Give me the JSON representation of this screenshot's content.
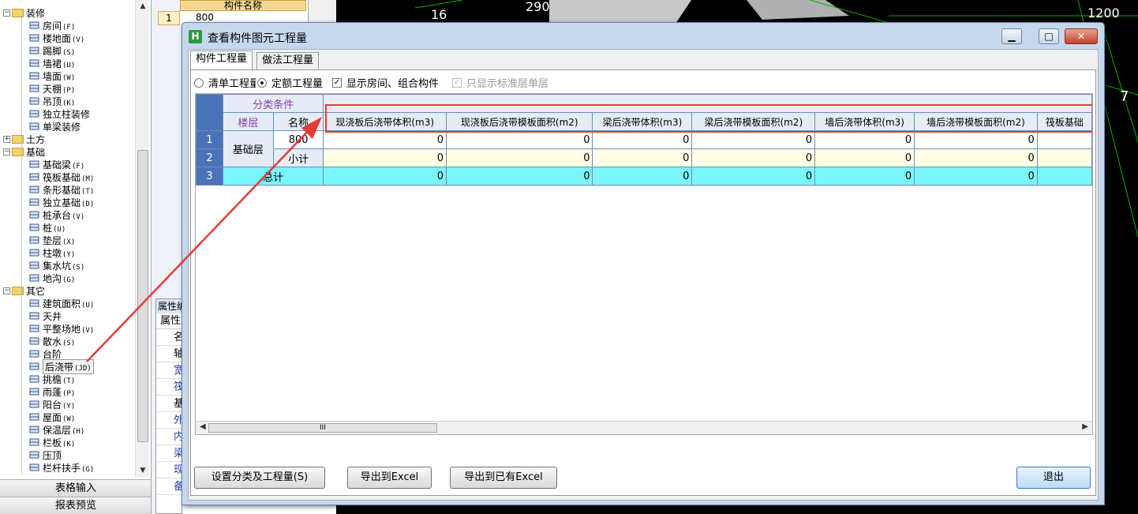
{
  "tree": {
    "categories": [
      {
        "label": "装修",
        "items": [
          {
            "label": "房间",
            "hotkey": "(F)",
            "icon": "room-icon"
          },
          {
            "label": "楼地面",
            "hotkey": "(V)",
            "icon": "floor-icon"
          },
          {
            "label": "踢脚",
            "hotkey": "(S)",
            "icon": "skirting-icon"
          },
          {
            "label": "墙裙",
            "hotkey": "(U)",
            "icon": "wainscot-icon"
          },
          {
            "label": "墙面",
            "hotkey": "(W)",
            "icon": "wall-surface-icon"
          },
          {
            "label": "天棚",
            "hotkey": "(P)",
            "icon": "ceiling-icon"
          },
          {
            "label": "吊顶",
            "hotkey": "(K)",
            "icon": "suspended-ceiling-icon"
          },
          {
            "label": "独立柱装修",
            "hotkey": "",
            "icon": "column-finish-icon"
          },
          {
            "label": "单梁装修",
            "hotkey": "",
            "icon": "beam-finish-icon"
          }
        ]
      },
      {
        "label": "土方",
        "items": []
      },
      {
        "label": "基础",
        "items": [
          {
            "label": "基础梁",
            "hotkey": "(F)",
            "icon": "foundation-beam-icon"
          },
          {
            "label": "筏板基础",
            "hotkey": "(M)",
            "icon": "raft-icon"
          },
          {
            "label": "条形基础",
            "hotkey": "(T)",
            "icon": "strip-foundation-icon"
          },
          {
            "label": "独立基础",
            "hotkey": "(D)",
            "icon": "isolated-foundation-icon"
          },
          {
            "label": "桩承台",
            "hotkey": "(V)",
            "icon": "pile-cap-icon"
          },
          {
            "label": "桩",
            "hotkey": "(U)",
            "icon": "pile-icon"
          },
          {
            "label": "垫层",
            "hotkey": "(X)",
            "icon": "cushion-icon"
          },
          {
            "label": "柱墩",
            "hotkey": "(Y)",
            "icon": "column-pier-icon"
          },
          {
            "label": "集水坑",
            "hotkey": "(S)",
            "icon": "sump-icon"
          },
          {
            "label": "地沟",
            "hotkey": "(G)",
            "icon": "trench-icon"
          }
        ]
      },
      {
        "label": "其它",
        "items": [
          {
            "label": "建筑面积",
            "hotkey": "(U)",
            "icon": "building-area-icon"
          },
          {
            "label": "天井",
            "hotkey": "",
            "icon": "patio-icon"
          },
          {
            "label": "平整场地",
            "hotkey": "(V)",
            "icon": "site-leveling-icon"
          },
          {
            "label": "散水",
            "hotkey": "(S)",
            "icon": "apron-icon"
          },
          {
            "label": "台阶",
            "hotkey": "",
            "icon": "steps-icon"
          },
          {
            "label": "后浇带",
            "hotkey": "(JD)",
            "icon": "post-cast-strip-icon"
          },
          {
            "label": "挑檐",
            "hotkey": "(T)",
            "icon": "eave-icon"
          },
          {
            "label": "雨蓬",
            "hotkey": "(P)",
            "icon": "canopy-icon"
          },
          {
            "label": "阳台",
            "hotkey": "(Y)",
            "icon": "balcony-icon"
          },
          {
            "label": "屋面",
            "hotkey": "(W)",
            "icon": "roof-icon"
          },
          {
            "label": "保温层",
            "hotkey": "(H)",
            "icon": "insulation-icon"
          },
          {
            "label": "栏板",
            "hotkey": "(K)",
            "icon": "parapet-icon"
          },
          {
            "label": "压顶",
            "hotkey": "",
            "icon": "coping-icon"
          },
          {
            "label": "栏杆扶手",
            "hotkey": "(G)",
            "icon": "railing-icon"
          }
        ]
      }
    ],
    "bottom_tabs": [
      "表格输入",
      "报表预览"
    ]
  },
  "behind": {
    "grid_header": "构件名称",
    "row_num": "1",
    "row_value": "800",
    "attr_title": "属性编",
    "attr_header": "属性",
    "attr_chars": [
      "名",
      "轴",
      "宽",
      "筏",
      "基",
      "外",
      "内",
      "梁",
      "现",
      "备"
    ]
  },
  "canvas": {
    "labels": [
      "16",
      "290",
      "1200",
      "7"
    ],
    "accent": "#00c000"
  },
  "dialog": {
    "title": "查看构件图元工程量",
    "controls": {
      "minimize": "▁",
      "maximize": "□",
      "close": "✕"
    },
    "tabs": [
      "构件工程量",
      "做法工程量"
    ],
    "options": {
      "radio_list": "清单工程量",
      "radio_quota": "定额工程量",
      "check_show_room": "显示房间、组合构件",
      "check_std_floor": "只显示标准层单层"
    },
    "grid": {
      "group_header": "分类条件",
      "col_floor": "楼层",
      "col_name": "名称",
      "quantity_headers": [
        "现浇板后浇带体积(m3)",
        "现浇板后浇带模板面积(m2)",
        "梁后浇带体积(m3)",
        "梁后浇带模板面积(m2)",
        "墙后浇带体积(m3)",
        "墙后浇带模板面积(m2)",
        "筏板基础"
      ],
      "rows": [
        {
          "num": "1",
          "floor": "基础层",
          "name": "800",
          "values": [
            "0",
            "0",
            "0",
            "0",
            "0",
            "0",
            ""
          ]
        },
        {
          "num": "2",
          "floor": "",
          "name": "小计",
          "values": [
            "0",
            "0",
            "0",
            "0",
            "0",
            "0",
            ""
          ]
        },
        {
          "num": "3",
          "floor": "总计",
          "name": "",
          "values": [
            "0",
            "0",
            "0",
            "0",
            "0",
            "0",
            ""
          ]
        }
      ],
      "scroll_grip": "III"
    },
    "buttons": {
      "set_category": "设置分类及工程量(S)",
      "export_excel": "导出到Excel",
      "export_existing": "导出到已有Excel",
      "exit": "退出"
    }
  },
  "colors": {
    "highlight": "#e53a3a",
    "header_blue": "#4a72b8",
    "total_cyan": "#7af5f8",
    "subtotal_yellow": "#ffffe4",
    "group_purple": "#8a3fb0"
  }
}
